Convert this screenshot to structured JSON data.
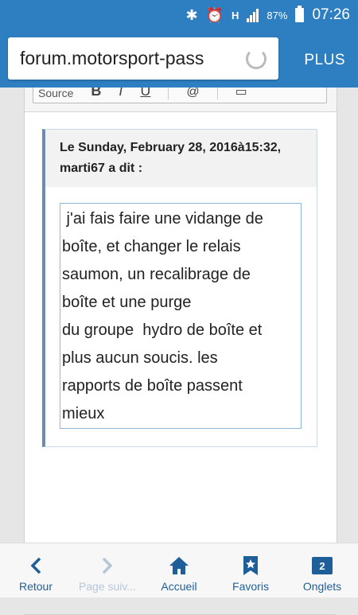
{
  "status_bar": {
    "battery_percent": "87%",
    "time": "07:26",
    "icons": [
      "bluetooth-icon",
      "alarm-icon",
      "hplus-network-icon",
      "signal-icon",
      "battery-icon"
    ]
  },
  "browser": {
    "url": "forum.motorsport-pass",
    "plus_label": "PLUS"
  },
  "editor": {
    "toolbar_source_label": "Source"
  },
  "quote": {
    "header": "Le Sunday, February 28, 2016à15:32, marti67 a dit :",
    "body_lines": [
      " j'ai fais faire une vidange de",
      "boîte, et changer le relais",
      "saumon, un recalibrage de",
      "boîte et une purge",
      "du groupe  hydro de boîte et",
      "plus aucun soucis. les",
      "rapports de boîte passent",
      "mieux"
    ]
  },
  "navbar": {
    "back": "Retour",
    "forward": "Page suiv...",
    "home": "Accueil",
    "bookmarks": "Favoris",
    "tabs": "Onglets",
    "tabs_count": "2"
  },
  "colors": {
    "accent": "#2e7fc1",
    "nav_icon": "#1f5f99"
  }
}
